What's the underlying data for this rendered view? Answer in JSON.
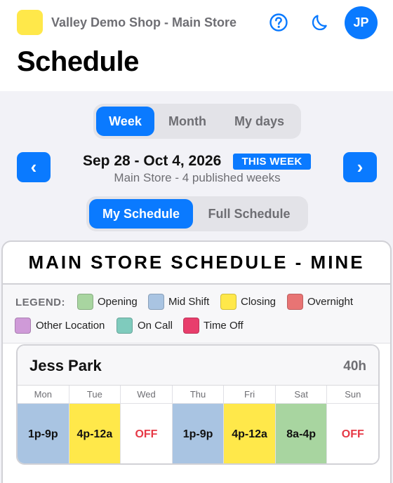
{
  "header": {
    "shop_name": "Valley Demo Shop - Main Store",
    "title": "Schedule",
    "avatar_initials": "JP",
    "logo_color": "#ffe84a",
    "accent": "#0a7aff"
  },
  "view_tabs": [
    {
      "label": "Week",
      "active": true
    },
    {
      "label": "Month",
      "active": false
    },
    {
      "label": "My days",
      "active": false
    }
  ],
  "week_nav": {
    "prev_label": "‹",
    "next_label": "›",
    "range": "Sep 28 - Oct 4, 2026",
    "badge": "THIS WEEK",
    "subtitle": "Main Store - 4 published weeks"
  },
  "scope_tabs": [
    {
      "label": "My Schedule",
      "active": true
    },
    {
      "label": "Full Schedule",
      "active": false
    }
  ],
  "panel": {
    "title": "MAIN STORE SCHEDULE - MINE"
  },
  "legend": {
    "label": "LEGEND:",
    "items": [
      {
        "label": "Opening",
        "color": "#a8d5a0"
      },
      {
        "label": "Mid Shift",
        "color": "#a9c4e2"
      },
      {
        "label": "Closing",
        "color": "#ffe84a"
      },
      {
        "label": "Overnight",
        "color": "#e87474"
      },
      {
        "label": "Other Location",
        "color": "#cf9ad8"
      },
      {
        "label": "On Call",
        "color": "#7fcbbd"
      },
      {
        "label": "Time Off",
        "color": "#e83e6c"
      }
    ]
  },
  "employee": {
    "name": "Jess Park",
    "hours": "40h",
    "days": [
      {
        "day": "Mon",
        "shift": "1p-9p",
        "color": "#a9c4e2"
      },
      {
        "day": "Tue",
        "shift": "4p-12a",
        "color": "#ffe84a"
      },
      {
        "day": "Wed",
        "shift": "OFF",
        "color": ""
      },
      {
        "day": "Thu",
        "shift": "1p-9p",
        "color": "#a9c4e2"
      },
      {
        "day": "Fri",
        "shift": "4p-12a",
        "color": "#ffe84a"
      },
      {
        "day": "Sat",
        "shift": "8a-4p",
        "color": "#a8d5a0"
      },
      {
        "day": "Sun",
        "shift": "OFF",
        "color": ""
      }
    ]
  },
  "icons": {
    "help": "help-circle-icon",
    "theme": "moon-icon"
  }
}
